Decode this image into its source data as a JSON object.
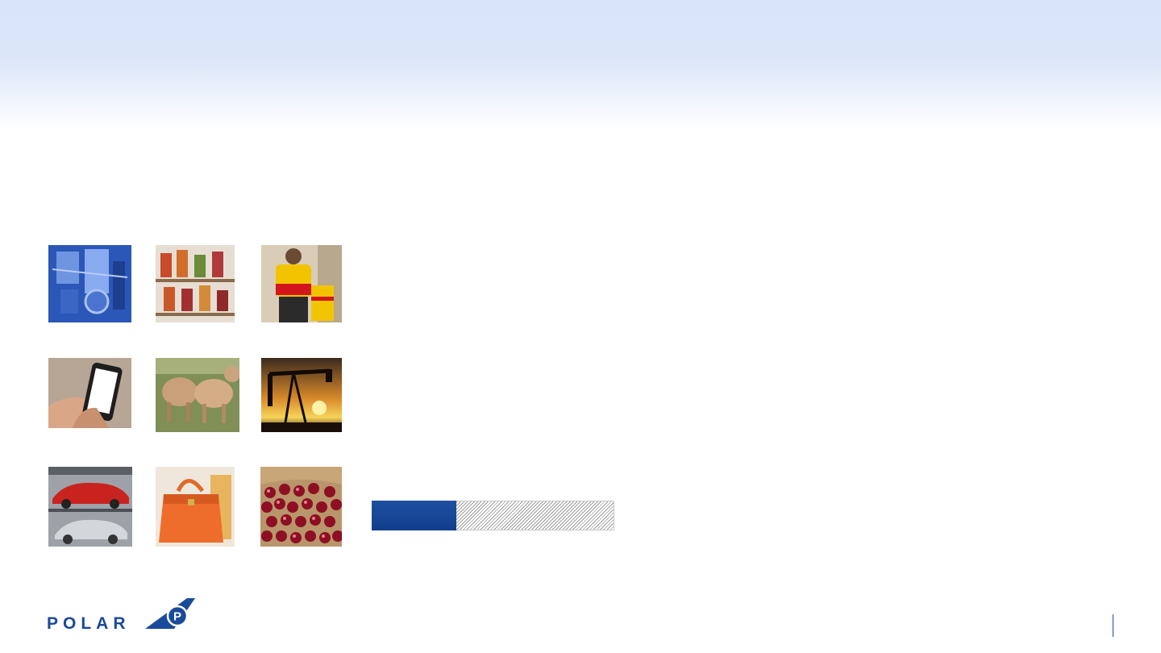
{
  "header": {
    "background": "#dbe5f9"
  },
  "tiles": [
    {
      "icon": "engine-machinery-image",
      "row": 1,
      "col": 1
    },
    {
      "icon": "pharmacy-jars-image",
      "row": 1,
      "col": 2
    },
    {
      "icon": "courier-parcel-image",
      "row": 1,
      "col": 3
    },
    {
      "icon": "smartphone-image",
      "row": 2,
      "col": 1
    },
    {
      "icon": "cattle-image",
      "row": 2,
      "col": 2
    },
    {
      "icon": "oil-pump-image",
      "row": 2,
      "col": 3
    },
    {
      "icon": "cars-assembly-image",
      "row": 3,
      "col": 1
    },
    {
      "icon": "handbag-image",
      "row": 3,
      "col": 2
    },
    {
      "icon": "cherries-image",
      "row": 3,
      "col": 3
    }
  ],
  "progress": {
    "value": 0.35,
    "fill_color": "#1a4a9a"
  },
  "logo": {
    "text": "POLAR",
    "emblem_letter": "P",
    "color": "#1a4a9a"
  }
}
